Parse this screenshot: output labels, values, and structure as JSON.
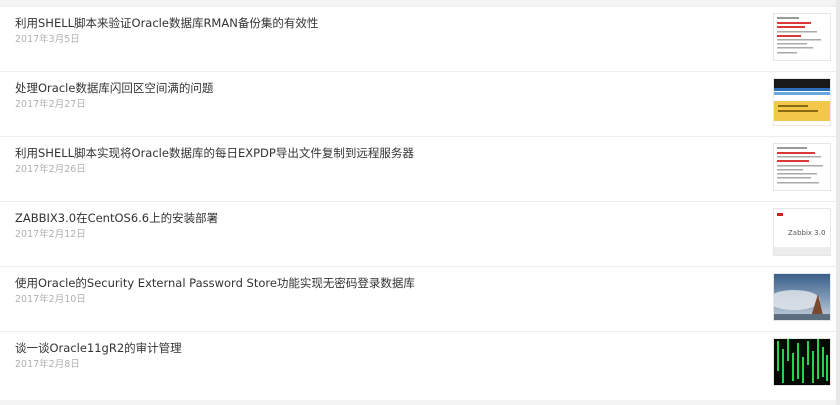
{
  "articles": [
    {
      "title": "利用SHELL脚本来验证Oracle数据库RMAN备份集的有效性",
      "date": "2017年3月5日",
      "thumb": "doc-red-icon"
    },
    {
      "title": "处理Oracle数据库闪回区空间满的问题",
      "date": "2017年2月27日",
      "thumb": "dark-yellow-icon"
    },
    {
      "title": "利用SHELL脚本实现将Oracle数据库的每日EXPDP导出文件复制到远程服务器",
      "date": "2017年2月26日",
      "thumb": "doc-red-icon"
    },
    {
      "title": "ZABBIX3.0在CentOS6.6上的安装部署",
      "date": "2017年2月12日",
      "thumb": "zabbix-icon",
      "thumb_text": "Zabbix 3.0"
    },
    {
      "title": "使用Oracle的Security External Password Store功能实现无密码登录数据库",
      "date": "2017年2月10日",
      "thumb": "photo-sky-icon"
    },
    {
      "title": "谈一谈Oracle11gR2的审计管理",
      "date": "2017年2月8日",
      "thumb": "matrix-icon"
    }
  ]
}
